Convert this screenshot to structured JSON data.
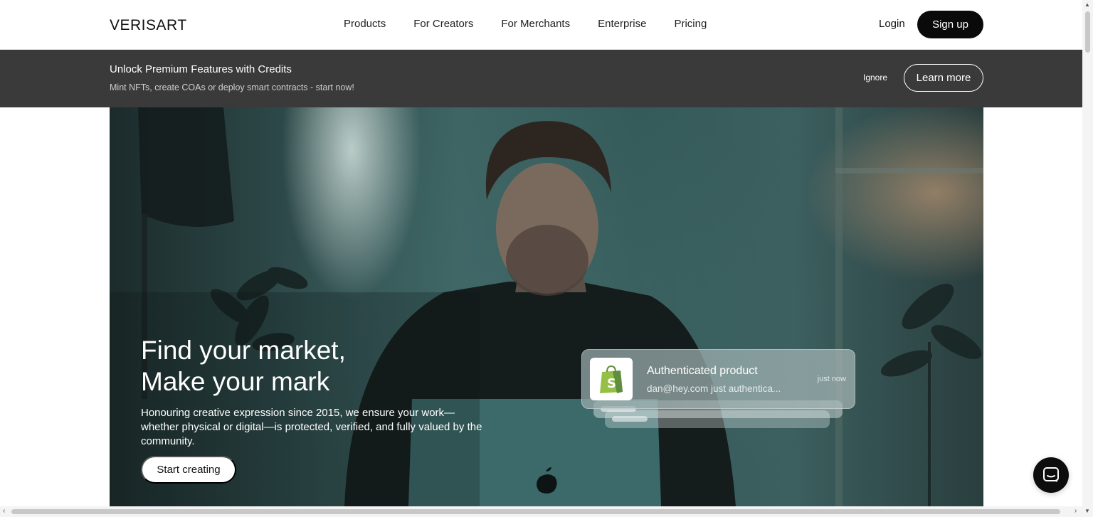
{
  "header": {
    "logo": "VERISART",
    "nav": [
      "Products",
      "For Creators",
      "For Merchants",
      "Enterprise",
      "Pricing"
    ],
    "login": "Login",
    "signup": "Sign up"
  },
  "banner": {
    "title": "Unlock Premium Features with Credits",
    "subtitle": "Mint NFTs, create COAs or deploy smart contracts - start now!",
    "ignore": "Ignore",
    "learn_more": "Learn more"
  },
  "hero": {
    "title_line1": "Find your market,",
    "title_line2": "Make your mark",
    "description": "Honouring creative expression since 2015, we ensure your work—whether physical or digital—is protected, verified, and fully valued by the community.",
    "cta": "Start creating"
  },
  "notification": {
    "title": "Authenticated product",
    "text": "dan@hey.com just authentica...",
    "time": "just now",
    "icon": "shopify-bag-icon"
  },
  "chat": {
    "icon": "chat-icon"
  },
  "colors": {
    "banner_bg": "#3a3a3a",
    "button_dark": "#0a0a0a",
    "shopify_green": "#95bf47"
  }
}
